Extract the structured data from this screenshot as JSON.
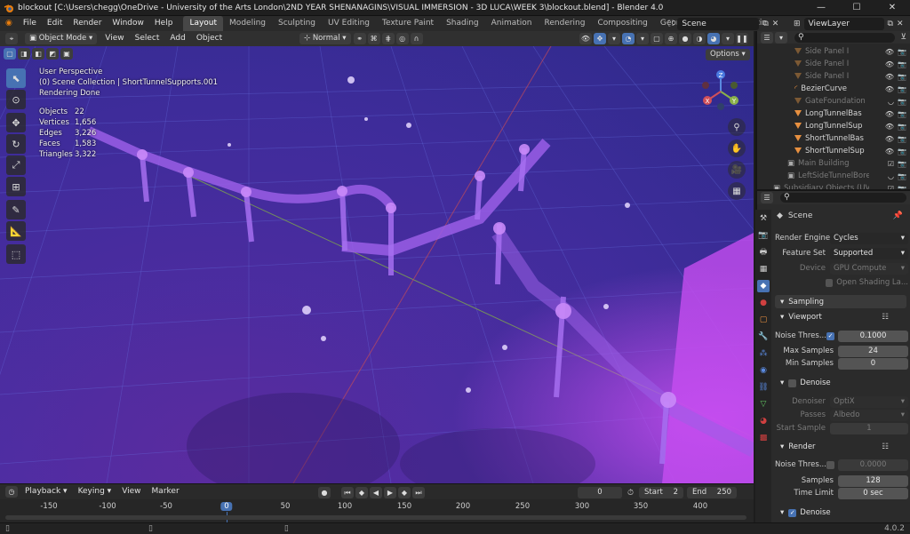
{
  "window": {
    "title": "blockout [C:\\Users\\chegg\\OneDrive - University of the Arts London\\2ND YEAR SHENANAGINS\\VISUAL IMMERSION - 3D LUCA\\WEEK 3\\blockout.blend] - Blender 4.0",
    "minimize": "—",
    "maximize": "☐",
    "close": "✕"
  },
  "menu": {
    "items": [
      "File",
      "Edit",
      "Render",
      "Window",
      "Help"
    ],
    "workspaces": [
      "Layout",
      "Modeling",
      "Sculpting",
      "UV Editing",
      "Texture Paint",
      "Shading",
      "Animation",
      "Rendering",
      "Compositing",
      "Geometry Nodes",
      "Scriptin"
    ],
    "active_workspace": "Layout",
    "scene": "Scene",
    "view_layer": "ViewLayer"
  },
  "viewport_header": {
    "mode": "Object Mode",
    "menus": [
      "View",
      "Select",
      "Add",
      "Object"
    ],
    "orientation": "Normal",
    "options": "Options"
  },
  "overlay": {
    "perspective": "User Perspective",
    "collection": "(0) Scene Collection | ShortTunnelSupports.001",
    "status": "Rendering Done",
    "stats": [
      {
        "label": "Objects",
        "value": "22"
      },
      {
        "label": "Vertices",
        "value": "1,656"
      },
      {
        "label": "Edges",
        "value": "3,226"
      },
      {
        "label": "Faces",
        "value": "1,583"
      },
      {
        "label": "Triangles",
        "value": "3,322"
      }
    ]
  },
  "gizmo": {
    "x": "X",
    "y": "Y",
    "z": "Z"
  },
  "timeline": {
    "menus": [
      "Playback",
      "Keying",
      "View",
      "Marker"
    ],
    "current_frame": "0",
    "start_label": "Start",
    "start": "2",
    "end_label": "End",
    "end": "250",
    "ruler": [
      "-150",
      "-100",
      "-50",
      "0",
      "50",
      "100",
      "150",
      "200",
      "250",
      "300",
      "350",
      "400"
    ]
  },
  "outliner": {
    "items": [
      {
        "name": "Side Panel I",
        "dim": true,
        "indent": 3
      },
      {
        "name": "Side Panel I",
        "dim": true,
        "indent": 3
      },
      {
        "name": "Side Panel I",
        "dim": true,
        "indent": 3
      },
      {
        "name": "BezierCurve",
        "dim": false,
        "indent": 2
      },
      {
        "name": "GateFoundation",
        "dim": true,
        "indent": 2
      },
      {
        "name": "LongTunnelBas",
        "dim": false,
        "indent": 2
      },
      {
        "name": "LongTunnelSup",
        "dim": false,
        "indent": 2
      },
      {
        "name": "ShortTunnelBas",
        "dim": false,
        "indent": 2
      },
      {
        "name": "ShortTunnelSup",
        "dim": false,
        "indent": 2
      },
      {
        "name": "Main Building",
        "dim": true,
        "indent": 1
      },
      {
        "name": "LeftSideTunnelBore",
        "dim": true,
        "indent": 1
      },
      {
        "name": "Subsidiary Objects (UV",
        "dim": true,
        "indent": 0
      }
    ]
  },
  "properties": {
    "context": "Scene",
    "render_engine_label": "Render Engine",
    "render_engine": "Cycles",
    "feature_set_label": "Feature Set",
    "feature_set": "Supported",
    "device_label": "Device",
    "device": "GPU Compute",
    "open_shading": "Open Shading La...",
    "sampling": "Sampling",
    "viewport": "Viewport",
    "noise_threshold_label": "Noise Thres...",
    "viewport_noise_threshold": "0.1000",
    "max_samples_label": "Max Samples",
    "max_samples": "24",
    "min_samples_label": "Min Samples",
    "min_samples": "0",
    "denoise": "Denoise",
    "denoiser_label": "Denoiser",
    "denoiser": "OptiX",
    "passes_label": "Passes",
    "passes": "Albedo",
    "start_sample_label": "Start Sample",
    "start_sample": "1",
    "render": "Render",
    "render_noise_threshold": "0.0000",
    "samples_label": "Samples",
    "samples": "128",
    "time_limit_label": "Time Limit",
    "time_limit": "0 sec",
    "render_denoise": "Denoise"
  },
  "status": {
    "version": "4.0.2"
  },
  "colors": {
    "accent": "#4772b3",
    "tunnel": "#9a5ee6",
    "grid": "#6a78e8",
    "axis_x": "#c24a5a",
    "axis_y": "#7fa84a"
  }
}
